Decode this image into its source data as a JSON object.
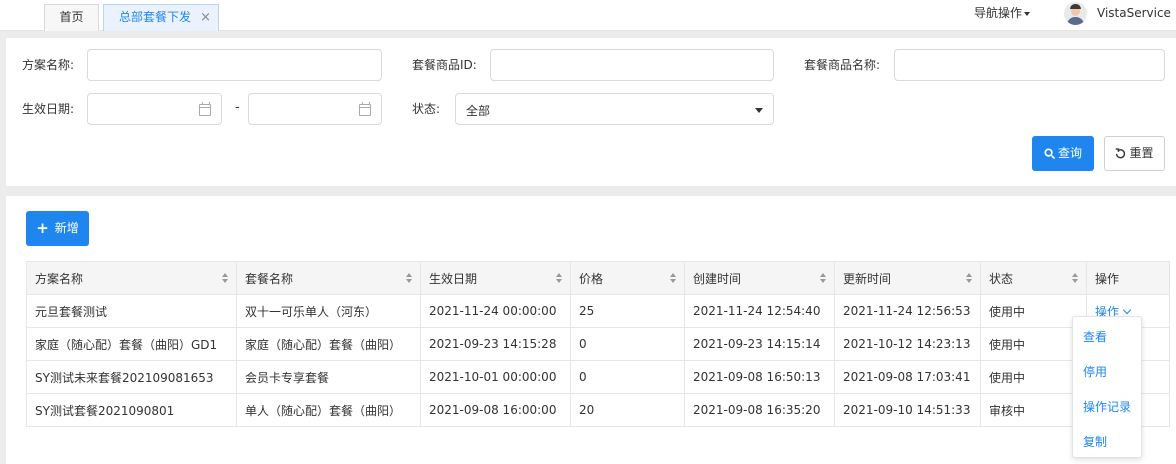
{
  "tabs": [
    {
      "label": "首页"
    },
    {
      "label": "总部套餐下发",
      "close": "×"
    }
  ],
  "header": {
    "nav_ops": "导航操作",
    "user": "VistaService"
  },
  "filters": {
    "plan_name_label": "方案名称:",
    "product_id_label": "套餐商品ID:",
    "product_name_label": "套餐商品名称:",
    "date_label": "生效日期:",
    "date_sep": "-",
    "status_label": "状态:",
    "status_value": "全部",
    "query_label": "查询",
    "reset_label": "重置"
  },
  "add_label": "新增",
  "table": {
    "columns": [
      "方案名称",
      "套餐名称",
      "生效日期",
      "价格",
      "创建时间",
      "更新时间",
      "状态",
      "操作"
    ],
    "rows": [
      [
        "元旦套餐测试",
        "双十一可乐单人（河东）",
        "2021-11-24 00:00:00",
        "25",
        "2021-11-24 12:54:40",
        "2021-11-24 12:56:53",
        "使用中",
        "操作"
      ],
      [
        "家庭（随心配）套餐（曲阳）GD1",
        "家庭（随心配）套餐（曲阳）",
        "2021-09-23 14:15:28",
        "0",
        "2021-09-23 14:15:14",
        "2021-10-12 14:23:13",
        "使用中",
        ""
      ],
      [
        "SY测试未来套餐202109081653",
        "会员卡专享套餐",
        "2021-10-01 00:00:00",
        "0",
        "2021-09-08 16:50:13",
        "2021-09-08 17:03:41",
        "使用中",
        ""
      ],
      [
        "SY测试套餐2021090801",
        "单人（随心配）套餐（曲阳）",
        "2021-09-08 16:00:00",
        "20",
        "2021-09-08 16:35:20",
        "2021-09-10 14:51:33",
        "审核中",
        ""
      ]
    ]
  },
  "dropdown": [
    "查看",
    "停用",
    "操作记录",
    "复制"
  ],
  "colors": {
    "primary": "#1f86ef",
    "page_bg": "#ececec"
  }
}
